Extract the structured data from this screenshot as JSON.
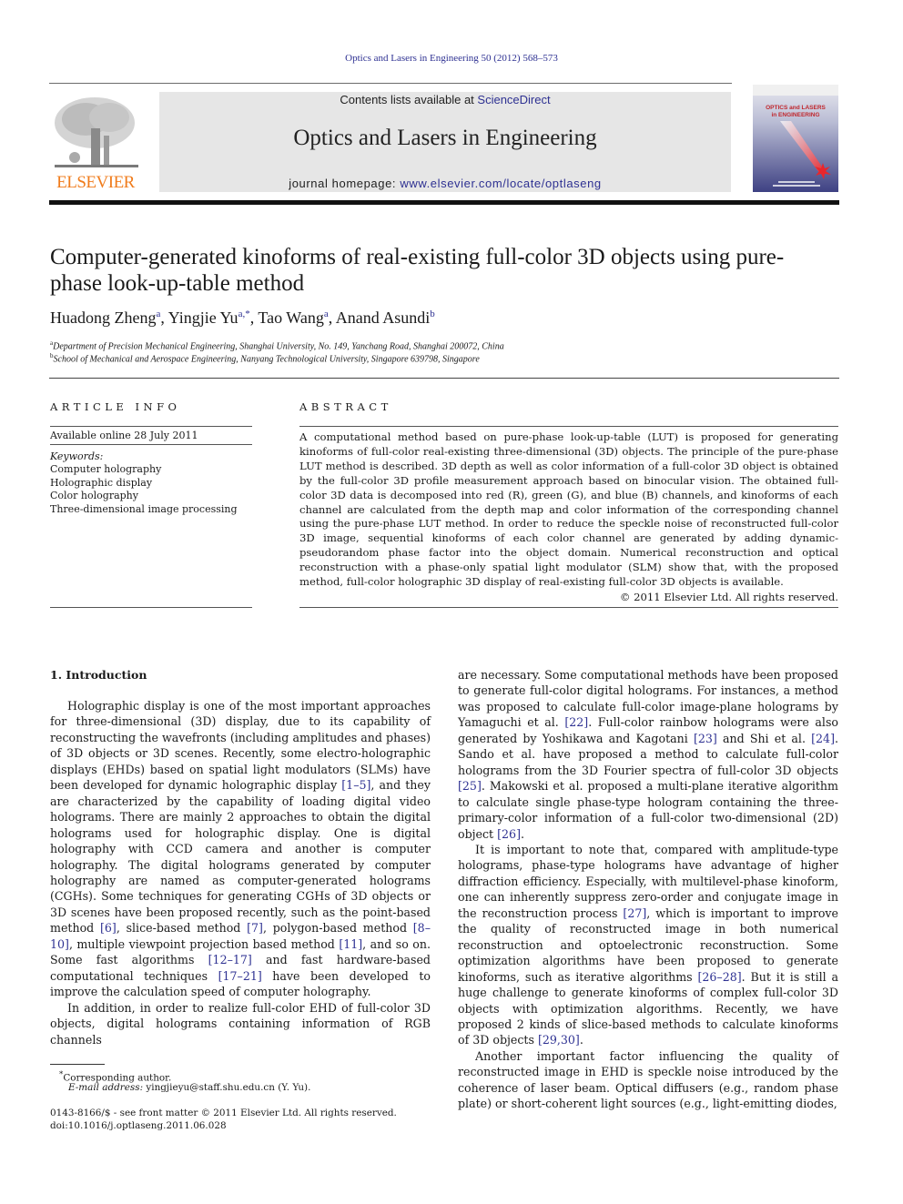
{
  "header": {
    "running_head": "Optics and Lasers in Engineering 50 (2012) 568–573",
    "contents_prefix": "Contents lists available at ",
    "contents_link": "ScienceDirect",
    "journal_title": "Optics and Lasers in Engineering",
    "homepage_prefix": "journal homepage: ",
    "homepage_link": "www.elsevier.com/locate/optlaseng",
    "publisher_logo_text": "ELSEVIER",
    "cover_title_line1": "OPTICS and LASERS",
    "cover_title_line2": "in ENGINEERING",
    "colors": {
      "link": "#2e3192",
      "elsevier_orange": "#f07c1c",
      "banner_bg": "#e6e6e6"
    }
  },
  "article": {
    "title": "Computer-generated kinoforms of real-existing full-color 3D objects using pure-phase look-up-table method",
    "authors": [
      {
        "name": "Huadong Zheng",
        "sup": "a"
      },
      {
        "name": "Yingjie Yu",
        "sup": "a,*"
      },
      {
        "name": "Tao Wang",
        "sup": "a"
      },
      {
        "name": "Anand Asundi",
        "sup": "b"
      }
    ],
    "affiliations": [
      {
        "sup": "a",
        "text": "Department of Precision Mechanical Engineering, Shanghai University, No. 149, Yanchang Road, Shanghai 200072, China"
      },
      {
        "sup": "b",
        "text": "School of Mechanical and Aerospace Engineering, Nanyang Technological University, Singapore 639798, Singapore"
      }
    ]
  },
  "article_info": {
    "heading": "ARTICLE INFO",
    "available_online": "Available online 28 July 2011",
    "keywords_label": "Keywords:",
    "keywords": [
      "Computer holography",
      "Holographic display",
      "Color holography",
      "Three-dimensional image processing"
    ]
  },
  "abstract": {
    "heading": "ABSTRACT",
    "text": "A computational method based on pure-phase look-up-table (LUT) is proposed for generating kinoforms of full-color real-existing three-dimensional (3D) objects. The principle of the pure-phase LUT method is described. 3D depth as well as color information of a full-color 3D object is obtained by the full-color 3D profile measurement approach based on binocular vision. The obtained full-color 3D data is decomposed into red (R), green (G), and blue (B) channels, and kinoforms of each channel are calculated from the depth map and color information of the corresponding channel using the pure-phase LUT method. In order to reduce the speckle noise of reconstructed full-color 3D image, sequential kinoforms of each color channel are generated by adding dynamic-pseudorandom phase factor into the object domain. Numerical reconstruction and optical reconstruction with a phase-only spatial light modulator (SLM) show that, with the proposed method, full-color holographic 3D display of real-existing full-color 3D objects is available.",
    "copyright": "© 2011 Elsevier Ltd. All rights reserved."
  },
  "introduction": {
    "heading": "1.  Introduction",
    "left_column": {
      "p1": [
        {
          "t": "Holographic display is one of the most important approaches for three-dimensional (3D) display, due to its capability of reconstructing the wavefronts (including amplitudes and phases) of 3D objects or 3D scenes. Recently, some electro-holographic displays (EHDs) based on spatial light modulators (SLMs) have been developed for dynamic holographic display "
        },
        {
          "r": "[1–5]"
        },
        {
          "t": ", and they are characterized by the capability of loading digital video holograms. There are mainly 2 approaches to obtain the digital holograms used for holographic display. One is digital holography with CCD camera and another is computer holography. The digital holograms generated by computer holography are named as computer-generated holograms (CGHs). Some techniques for generating CGHs of 3D objects or 3D scenes have been proposed recently, such as the point-based method "
        },
        {
          "r": "[6]"
        },
        {
          "t": ", slice-based method "
        },
        {
          "r": "[7]"
        },
        {
          "t": ", polygon-based method "
        },
        {
          "r": "[8–10]"
        },
        {
          "t": ", multiple viewpoint projection based method "
        },
        {
          "r": "[11]"
        },
        {
          "t": ", and so on. Some fast algorithms "
        },
        {
          "r": "[12–17]"
        },
        {
          "t": " and fast hardware-based computational techniques "
        },
        {
          "r": "[17–21]"
        },
        {
          "t": " have been developed to improve the calculation speed of computer holography."
        }
      ],
      "p2": [
        {
          "t": "In addition, in order to realize full-color EHD of full-color 3D objects, digital holograms containing information of RGB channels"
        }
      ]
    },
    "right_column": {
      "p1": [
        {
          "t": "are necessary. Some computational methods have been proposed to generate full-color digital holograms. For instances, a method was proposed to calculate full-color image-plane holograms by Yamaguchi et al. "
        },
        {
          "r": "[22]"
        },
        {
          "t": ". Full-color rainbow holograms were also generated by Yoshikawa and Kagotani "
        },
        {
          "r": "[23]"
        },
        {
          "t": " and Shi et al. "
        },
        {
          "r": "[24]"
        },
        {
          "t": ". Sando et al. have proposed a method to calculate full-color holograms from the 3D Fourier spectra of full-color 3D objects "
        },
        {
          "r": "[25]"
        },
        {
          "t": ". Makowski et al. proposed a multi-plane iterative algorithm to calculate single phase-type hologram containing the three-primary-color information of a full-color two-dimensional (2D) object "
        },
        {
          "r": "[26]"
        },
        {
          "t": "."
        }
      ],
      "p2": [
        {
          "t": "It is important to note that, compared with amplitude-type holograms, phase-type holograms have advantage of higher diffraction efficiency. Especially, with multilevel-phase kinoform, one can inherently suppress zero-order and conjugate image in the reconstruction process "
        },
        {
          "r": "[27]"
        },
        {
          "t": ", which is important to improve the quality of reconstructed image in both numerical reconstruction and optoelectronic reconstruction. Some optimization algorithms have been proposed to generate kinoforms, such as iterative algorithms "
        },
        {
          "r": "[26–28]"
        },
        {
          "t": ". But it is still a huge challenge to generate kinoforms of complex full-color 3D objects with optimization algorithms. Recently, we have proposed 2 kinds of slice-based methods to calculate kinoforms of 3D objects "
        },
        {
          "r": "[29,30]"
        },
        {
          "t": "."
        }
      ],
      "p3": [
        {
          "t": "Another important factor influencing the quality of reconstructed image in EHD is speckle noise introduced by the coherence of laser beam. Optical diffusers (e.g., random phase plate) or short-coherent light sources (e.g., light-emitting diodes,"
        }
      ]
    }
  },
  "footnotes": {
    "corresponding_mark": "*",
    "corresponding": "Corresponding author.",
    "email_label": "E-mail address:",
    "email": "yingjieyu@staff.shu.edu.cn (Y. Yu).",
    "issn_line": "0143-8166/$ - see front matter © 2011 Elsevier Ltd. All rights reserved.",
    "doi": "doi:10.1016/j.optlaseng.2011.06.028"
  }
}
